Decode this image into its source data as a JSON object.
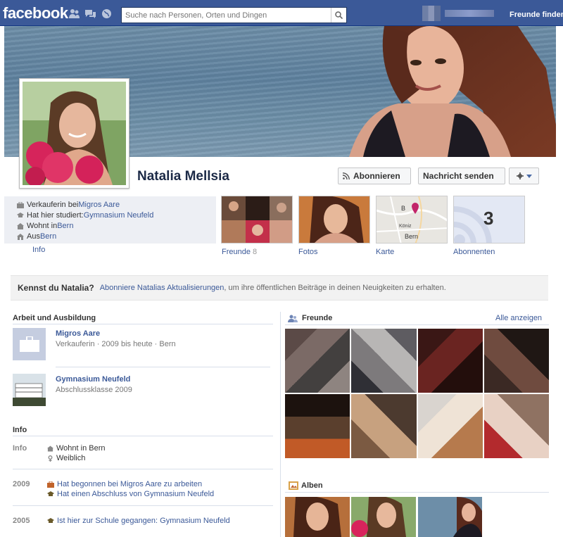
{
  "topbar": {
    "logo": "facebook",
    "search_placeholder": "Suche nach Personen, Orten und Dingen",
    "friends_find": "Freunde finden"
  },
  "profile": {
    "name": "Natalia Mellsia",
    "subscribe_label": "Abonnieren",
    "message_label": "Nachricht senden"
  },
  "info_bar": {
    "items": [
      {
        "prefix": "Verkauferin bei ",
        "link": "Migros Aare"
      },
      {
        "prefix": "Hat hier studiert: ",
        "link": "Gymnasium Neufeld"
      },
      {
        "prefix": "Wohnt in ",
        "link": "Bern"
      },
      {
        "prefix": "Aus ",
        "link": "Bern"
      }
    ],
    "info_link": "Info"
  },
  "tiles": {
    "friends_label": "Freunde",
    "friends_count": "8",
    "photos_label": "Fotos",
    "map_label": "Karte",
    "subscribers_label": "Abonnenten",
    "subscribers_count": "3",
    "map_places": [
      "B",
      "Köniz",
      "Bern"
    ]
  },
  "know_bar": {
    "title": "Kennst du Natalia?",
    "link": "Abonniere Natalias Aktualisierungen",
    "text": ", um ihre öffentlichen Beiträge in deinen Neuigkeiten zu erhalten."
  },
  "work": {
    "title": "Arbeit und Ausbildung",
    "items": [
      {
        "name": "Migros Aare",
        "sub": "Verkauferin · 2009 bis heute · Bern"
      },
      {
        "name": "Gymnasium Neufeld",
        "sub": "Abschlussklasse 2009"
      }
    ]
  },
  "info": {
    "title": "Info",
    "rows": [
      {
        "label": "Info",
        "lines": [
          "Wohnt in Bern",
          "Weiblich"
        ]
      },
      {
        "label": "2009",
        "lines": [
          "Hat begonnen bei Migros Aare zu arbeiten",
          "Hat einen Abschluss von Gymnasium Neufeld"
        ]
      },
      {
        "label": "2005",
        "lines": [
          "Ist hier zur Schule gegangen: Gymnasium Neufeld"
        ]
      }
    ],
    "info_row_links": [
      "Bern"
    ]
  },
  "friends_box": {
    "title": "Freunde",
    "see_all": "Alle anzeigen"
  },
  "albums": {
    "title": "Alben"
  }
}
